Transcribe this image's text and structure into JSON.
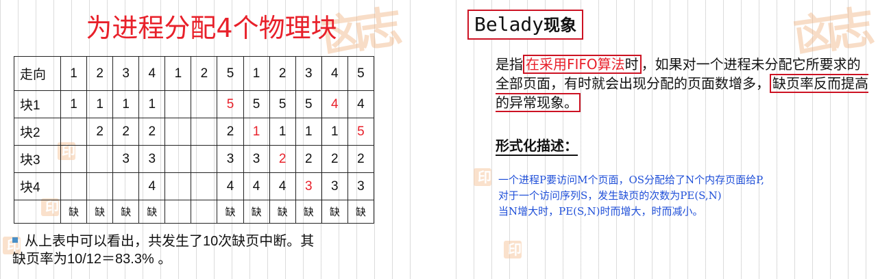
{
  "left_slide": {
    "title": "为进程分配4个物理块",
    "table": {
      "rows": [
        {
          "label": "走向",
          "cells": [
            "1",
            "2",
            "3",
            "4",
            "1",
            "2",
            "5",
            "1",
            "2",
            "3",
            "4",
            "5"
          ],
          "red": []
        },
        {
          "label": "块1",
          "cells": [
            "1",
            "1",
            "1",
            "1",
            "",
            "",
            "5",
            "5",
            "5",
            "5",
            "4",
            "4"
          ],
          "red": [
            6,
            10
          ]
        },
        {
          "label": "块2",
          "cells": [
            "",
            "2",
            "2",
            "2",
            "",
            "",
            "2",
            "1",
            "1",
            "1",
            "1",
            "5"
          ],
          "red": [
            7,
            11
          ]
        },
        {
          "label": "块3",
          "cells": [
            "",
            "",
            "3",
            "3",
            "",
            "",
            "3",
            "3",
            "2",
            "2",
            "2",
            "2"
          ],
          "red": [
            8
          ]
        },
        {
          "label": "块4",
          "cells": [
            "",
            "",
            "",
            "4",
            "",
            "",
            "4",
            "4",
            "4",
            "3",
            "3",
            "3"
          ],
          "red": [
            9
          ]
        },
        {
          "label": "",
          "cells": [
            "缺",
            "缺",
            "缺",
            "缺",
            "",
            "",
            "缺",
            "缺",
            "缺",
            "缺",
            "缺",
            "缺"
          ],
          "red": []
        }
      ]
    },
    "bullet_line1": "从上表中可以看出，共发生了10次缺页中断。其",
    "bullet_line2": "缺页率为10/12＝83.3% 。"
  },
  "right_slide": {
    "title_latin": "Belady",
    "title_cjk": "现象",
    "para_prefix": "是指",
    "para_boxed_red": "在采用FIFO算法",
    "para_boxed_tail": "时",
    "para_rest1": "，如果对一个进程未分配它所要求的全部页面，有时就会出现分配的页面数增多，",
    "para_boxed2": "缺页率反而提高的异常现象。",
    "subhead": "形式化描述：",
    "formal_line1": "一个进程P要访问M个页面，OS分配给了N个内存页面给P,",
    "formal_line2": "对于一个访问序列S，发生缺页的次数为PE(S,N)",
    "formal_line3": "当N增大时，PE(S,N)时而增大，时而减小。"
  },
  "colors": {
    "accent_red": "#e8202a",
    "box_red": "#cc1122",
    "formal_blue": "#1f4fd8",
    "bullet_blue": "#4a90c8"
  }
}
